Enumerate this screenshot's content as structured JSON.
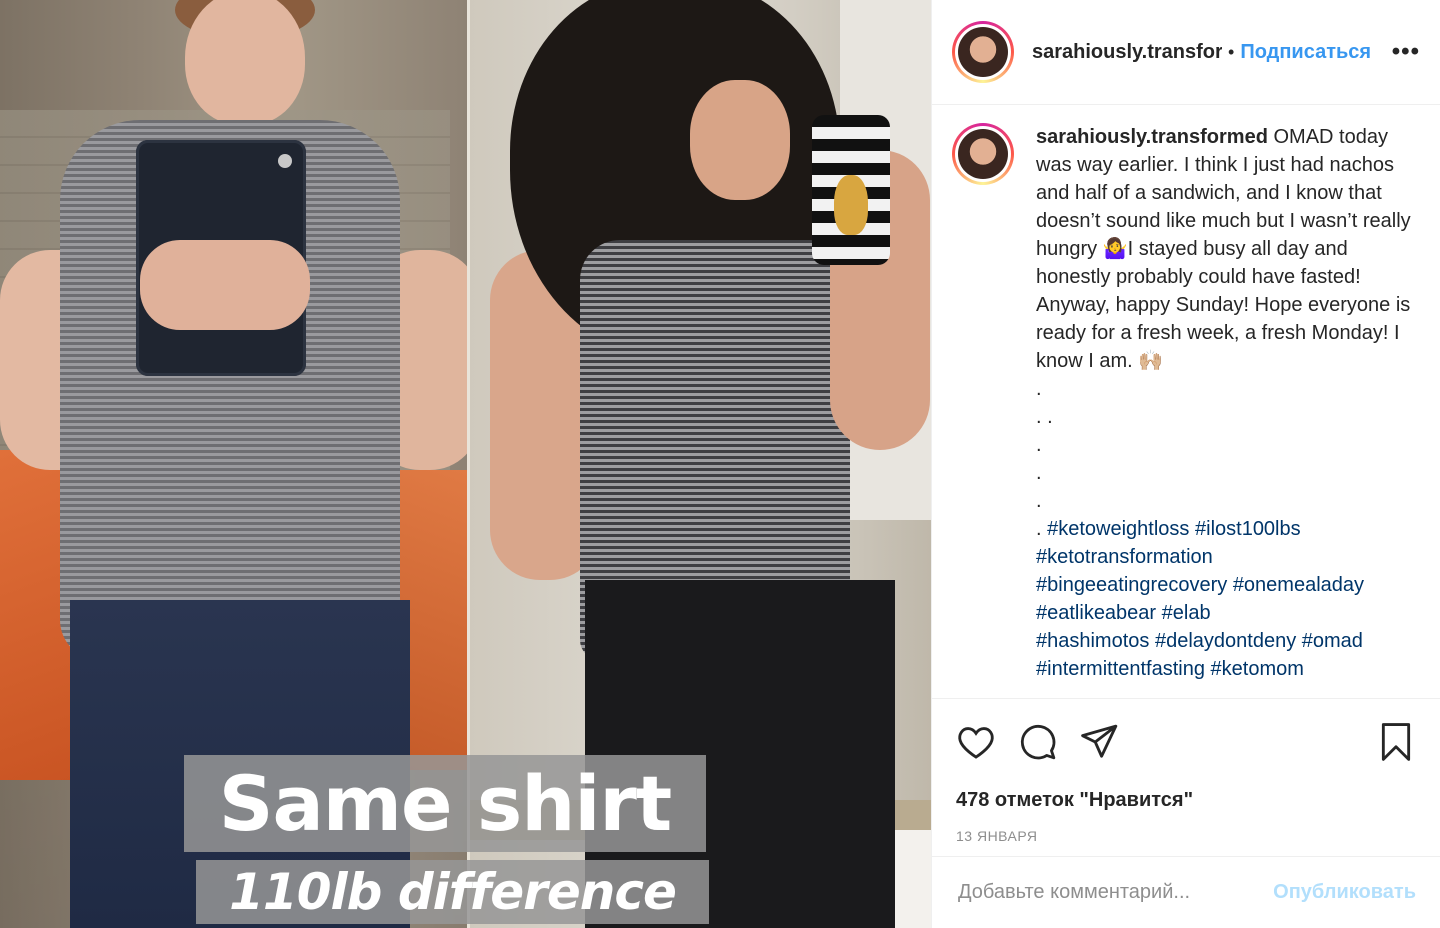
{
  "photo": {
    "caption_line1": "Same shirt",
    "caption_line2": "110lb difference"
  },
  "header": {
    "username": "sarahiously.transformed",
    "separator": "•",
    "follow_label": "Подписаться",
    "more_label": "•••"
  },
  "post": {
    "username": "sarahiously.transformed",
    "text": " OMAD today was way earlier. I think I just had nachos and half of a sandwich, and I know that doesn’t sound like much but I wasn’t really hungry 🤷‍♀️I stayed busy all day and honestly probably could have fasted! Anyway, happy Sunday! Hope everyone is ready for a fresh week, a fresh Monday! I know I am. 🙌🏼",
    "dots": [
      ".",
      ". .",
      ".",
      ".",
      "."
    ],
    "hashtag_prefix": ". ",
    "hashtags": [
      "#ketoweightloss",
      "#ilost100lbs",
      "#ketotransformation",
      "#bingeeatingrecovery",
      "#onemealaday",
      "#eatlikeabear",
      "#elab",
      "#hashimotos",
      "#delaydontdeny",
      "#omad",
      "#intermittentfasting",
      "#ketomom"
    ]
  },
  "actions": {
    "like_icon": "heart-icon",
    "comment_icon": "speech-bubble-icon",
    "share_icon": "paper-plane-icon",
    "save_icon": "bookmark-icon"
  },
  "likes": "478 отметок \"Нравится\"",
  "date": "13 ЯНВАРЯ",
  "comment": {
    "placeholder": "Добавьте комментарий...",
    "publish_label": "Опубликовать"
  },
  "colors": {
    "link_blue": "#3897f0",
    "hashtag": "#003569",
    "publish_disabled": "#b2dffc",
    "muted": "#8e8e8e"
  }
}
